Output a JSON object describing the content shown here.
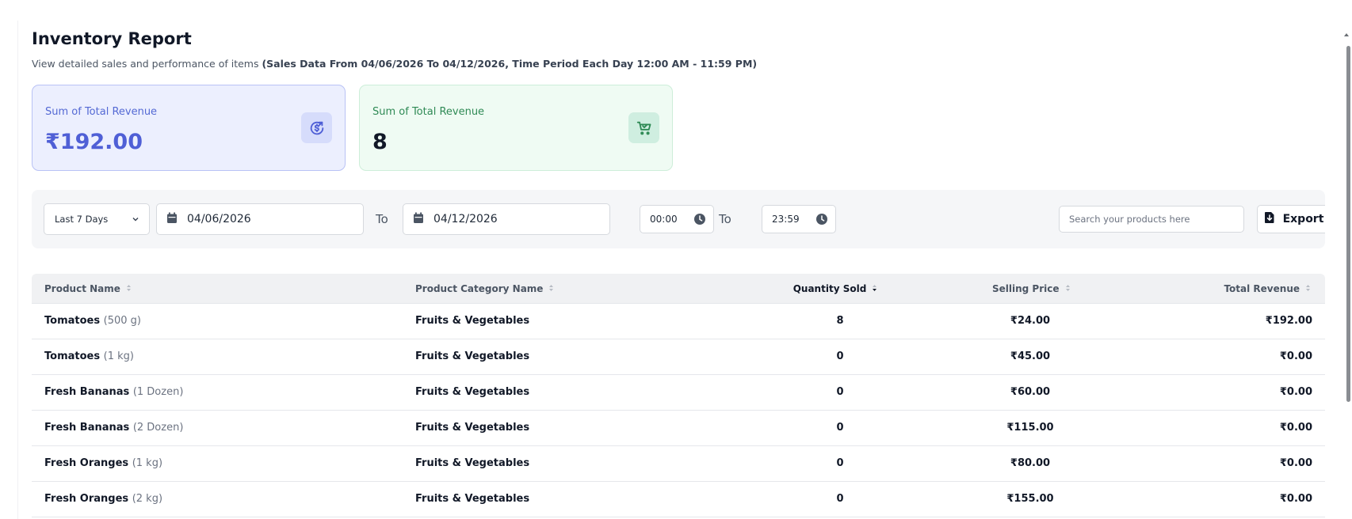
{
  "header": {
    "title": "Inventory Report",
    "subtitle_prefix": "View detailed sales and performance of items ",
    "subtitle_bold": "(Sales Data From 04/06/2026 To 04/12/2026, Time Period Each Day 12:00 AM - 11:59 PM)"
  },
  "cards": [
    {
      "label": "Sum of Total Revenue",
      "value": "₹192.00",
      "icon": "revenue-cycle-icon",
      "accent": "#4f5fd6"
    },
    {
      "label": "Sum of Total Revenue",
      "value": "8",
      "icon": "cart-icon",
      "accent": "#2f8a55"
    }
  ],
  "filters": {
    "range_select": "Last 7 Days",
    "start_date": "04/06/2026",
    "to_label_1": "To",
    "end_date": "04/12/2026",
    "start_time": "00:00",
    "to_label_2": "To",
    "end_time": "23:59",
    "search_placeholder": "Search your products here",
    "export_label": "Export"
  },
  "table": {
    "columns": [
      "Product Name",
      "Product Category Name",
      "Quantity Sold",
      "Selling Price",
      "Total Revenue"
    ],
    "rows": [
      {
        "name": "Tomatoes",
        "variant": "(500 g)",
        "category": "Fruits & Vegetables",
        "qty": "8",
        "price": "₹24.00",
        "revenue": "₹192.00"
      },
      {
        "name": "Tomatoes",
        "variant": "(1 kg)",
        "category": "Fruits & Vegetables",
        "qty": "0",
        "price": "₹45.00",
        "revenue": "₹0.00"
      },
      {
        "name": "Fresh Bananas",
        "variant": "(1 Dozen)",
        "category": "Fruits & Vegetables",
        "qty": "0",
        "price": "₹60.00",
        "revenue": "₹0.00"
      },
      {
        "name": "Fresh Bananas",
        "variant": "(2 Dozen)",
        "category": "Fruits & Vegetables",
        "qty": "0",
        "price": "₹115.00",
        "revenue": "₹0.00"
      },
      {
        "name": "Fresh Oranges",
        "variant": "(1 kg)",
        "category": "Fruits & Vegetables",
        "qty": "0",
        "price": "₹80.00",
        "revenue": "₹0.00"
      },
      {
        "name": "Fresh Oranges",
        "variant": "(2 kg)",
        "category": "Fruits & Vegetables",
        "qty": "0",
        "price": "₹155.00",
        "revenue": "₹0.00"
      }
    ]
  }
}
